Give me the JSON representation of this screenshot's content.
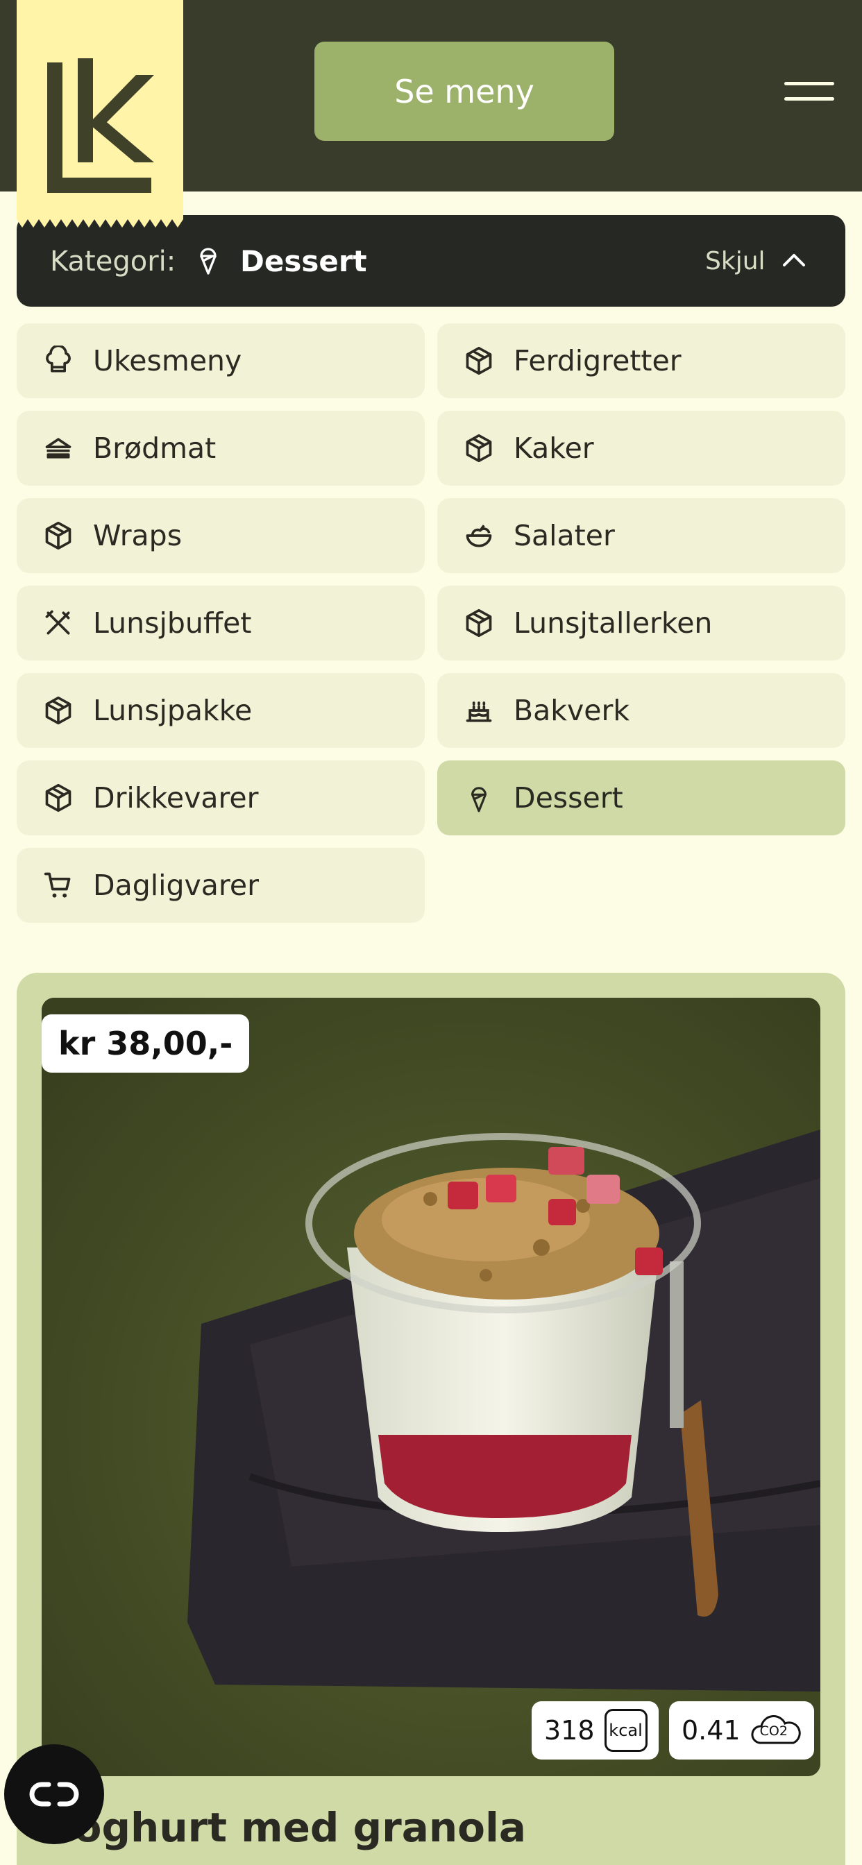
{
  "header": {
    "logo_alt": "LK",
    "menu_button": "Se meny",
    "colors": {
      "header_bg": "#393c2b",
      "logo_bg": "#fff4a8",
      "button_bg": "#9cb26a"
    }
  },
  "category_bar": {
    "label": "Kategori:",
    "selected": "Dessert",
    "selected_icon": "ice-cream-icon",
    "toggle_label": "Skjul"
  },
  "categories": [
    {
      "label": "Ukesmeny",
      "icon": "chef-hat-icon",
      "active": false
    },
    {
      "label": "Ferdigretter",
      "icon": "box-icon",
      "active": false
    },
    {
      "label": "Brødmat",
      "icon": "sandwich-icon",
      "active": false
    },
    {
      "label": "Kaker",
      "icon": "box-icon",
      "active": false
    },
    {
      "label": "Wraps",
      "icon": "box-icon",
      "active": false
    },
    {
      "label": "Salater",
      "icon": "salad-icon",
      "active": false
    },
    {
      "label": "Lunsjbuffet",
      "icon": "utensils-crossed-icon",
      "active": false
    },
    {
      "label": "Lunsjtallerken",
      "icon": "box-icon",
      "active": false
    },
    {
      "label": "Lunsjpakke",
      "icon": "box-icon",
      "active": false
    },
    {
      "label": "Bakverk",
      "icon": "cake-icon",
      "active": false
    },
    {
      "label": "Drikkevarer",
      "icon": "box-icon",
      "active": false
    },
    {
      "label": "Dessert",
      "icon": "ice-cream-icon",
      "active": true
    },
    {
      "label": "Dagligvarer",
      "icon": "cart-icon",
      "active": false
    }
  ],
  "product": {
    "price": "kr 38,00,-",
    "kcal_value": "318",
    "kcal_unit": "kcal",
    "co2_value": "0.41",
    "co2_unit": "CO2",
    "title": "Yoghurt med granola"
  },
  "fab": {
    "icon": "chat-link-icon"
  }
}
